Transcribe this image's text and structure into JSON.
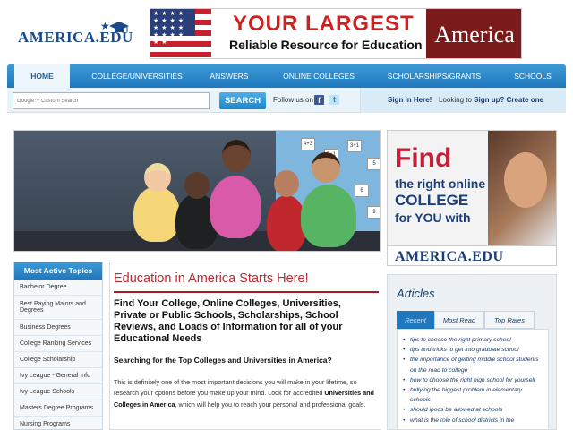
{
  "brand": {
    "logo_text": "AMERICA.EDU"
  },
  "top_banner": {
    "line1": "YOUR LARGEST",
    "line2": "Reliable Resource for Education in",
    "line3": "America"
  },
  "nav": {
    "items": [
      {
        "label": "HOME",
        "active": true
      },
      {
        "label": "COLLEGE/UNIVERSITIES"
      },
      {
        "label": "ANSWERS"
      },
      {
        "label": "ONLINE COLLEGES"
      },
      {
        "label": "SCHOLARSHIPS/GRANTS"
      },
      {
        "label": "SCHOOLS"
      }
    ]
  },
  "search": {
    "placeholder": "Google™ Custom Search",
    "button_label": "SEARCH"
  },
  "social": {
    "follow_label": "Follow us on",
    "facebook_glyph": "f",
    "twitter_glyph": "t"
  },
  "account": {
    "sign_in_label": "Sign in Here!",
    "sign_up_prefix": "Looking to ",
    "sign_up_label": "Sign up? Create one"
  },
  "hero": {
    "cards": [
      "4+3",
      "5+1",
      "3+1",
      "5",
      "6",
      "7",
      "9",
      "2"
    ]
  },
  "side_ad": {
    "find": "Find",
    "line2": "the right online",
    "line3": "COLLEGE",
    "line4": "for YOU with",
    "domain": "AMERICA.EDU"
  },
  "sidebar": {
    "title": "Most Active Topics",
    "items": [
      "Bachelor Degree",
      "Best Paying Majors and Degrees",
      "Business Degrees",
      "College Ranking Services",
      "College Scholarship",
      "Ivy League - General Info",
      "Ivy League Schools",
      "Masters Degree Programs",
      "Nursing Programs"
    ]
  },
  "main": {
    "title": "Education in America Starts Here!",
    "heading": "Find Your College, Online Colleges, Universities, Private or Public Schools, Scholarships, School Reviews, and Loads of Information for all of your Educational Needs",
    "subheading": "Searching for the Top Colleges and Universities in America?",
    "para_1": "This is definitely one of the most important decisions you will make in your lifetime, so research your options before you make up your mind. Look for accredited ",
    "para_bold": "Universities and Colleges in America",
    "para_2": ", which will help you to reach your personal and professional goals."
  },
  "articles": {
    "title": "Articles",
    "tabs": [
      {
        "label": "Recent",
        "active": true
      },
      {
        "label": "Most Read"
      },
      {
        "label": "Top Rates"
      }
    ],
    "items": [
      "tips to choose the right primary school",
      "tips and tricks to get into graduate school",
      "the importance of getting middle school students on the road to college",
      "how to choose the right high school for yourself",
      "bullying the biggest problem in elementary schools",
      "should ipods be allowed at schools",
      "what is the role of school districts in the"
    ]
  }
}
